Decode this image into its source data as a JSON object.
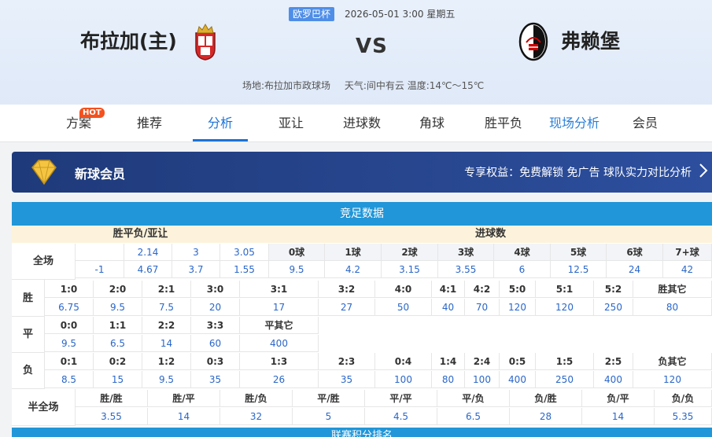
{
  "match": {
    "league": "欧罗巴杯",
    "datetime": "2026-05-01 3:00 星期五",
    "home_team": "布拉加(主)",
    "away_team": "弗赖堡",
    "vs": "VS",
    "venue": "场地:布拉加市政球场",
    "weather": "天气:间中有云 温度:14℃～15℃"
  },
  "tabs": [
    {
      "label": "方案"
    },
    {
      "label": "推荐"
    },
    {
      "label": "分析"
    },
    {
      "label": "亚让"
    },
    {
      "label": "进球数"
    },
    {
      "label": "角球"
    },
    {
      "label": "胜平负"
    },
    {
      "label": "现场分析"
    },
    {
      "label": "会员"
    }
  ],
  "hot_badge": "HOT",
  "member": {
    "title": "新球会员",
    "rights": "专享权益：免费解锁 免广告 球队实力对比分析"
  },
  "panel": {
    "title": "竞足数据",
    "sec_spf": "胜平负/亚让",
    "sec_goals": "进球数",
    "full_label": "全场",
    "spf_row1": [
      "",
      "2.14",
      "3",
      "3.05"
    ],
    "spf_row2": [
      "-1",
      "4.67",
      "3.7",
      "1.55"
    ],
    "goal_heads": [
      "0球",
      "1球",
      "2球",
      "3球",
      "4球",
      "5球",
      "6球",
      "7+球"
    ],
    "goal_vals": [
      "9.5",
      "4.2",
      "3.15",
      "3.55",
      "6",
      "12.5",
      "24",
      "42"
    ],
    "win_label": "胜",
    "win_heads": [
      "1:0",
      "2:0",
      "2:1",
      "3:0",
      "3:1",
      "3:2",
      "4:0",
      "4:1",
      "4:2",
      "5:0",
      "5:1",
      "5:2",
      "胜其它"
    ],
    "win_vals": [
      "6.75",
      "9.5",
      "7.5",
      "20",
      "17",
      "27",
      "50",
      "40",
      "70",
      "120",
      "120",
      "250",
      "80"
    ],
    "draw_label": "平",
    "draw_heads": [
      "0:0",
      "1:1",
      "2:2",
      "3:3",
      "平其它"
    ],
    "draw_vals": [
      "9.5",
      "6.5",
      "14",
      "60",
      "400"
    ],
    "lose_label": "负",
    "lose_heads": [
      "0:1",
      "0:2",
      "1:2",
      "0:3",
      "1:3",
      "2:3",
      "0:4",
      "1:4",
      "2:4",
      "0:5",
      "1:5",
      "2:5",
      "负其它"
    ],
    "lose_vals": [
      "8.5",
      "15",
      "9.5",
      "35",
      "26",
      "35",
      "100",
      "80",
      "100",
      "400",
      "250",
      "400",
      "120"
    ],
    "half_label": "半全场",
    "half_heads": [
      "胜/胜",
      "胜/平",
      "胜/负",
      "平/胜",
      "平/平",
      "平/负",
      "负/胜",
      "负/平",
      "负/负"
    ],
    "half_vals": [
      "3.55",
      "14",
      "32",
      "5",
      "4.5",
      "6.5",
      "28",
      "14",
      "5.35"
    ],
    "bottom_title": "联赛积分排名"
  }
}
